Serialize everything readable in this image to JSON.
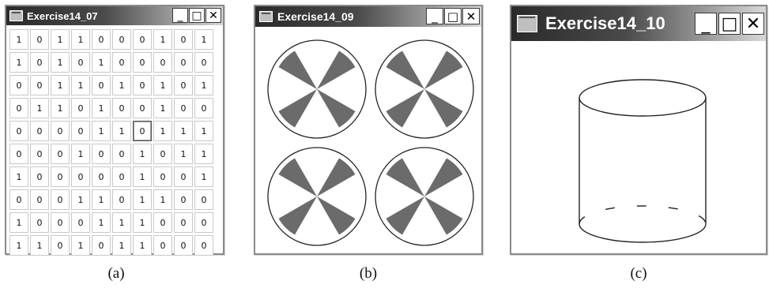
{
  "windows": {
    "a": {
      "title": "Exercise14_07",
      "controls": {
        "minimize": "_",
        "maximize": "□",
        "close": "✕"
      },
      "matrix": [
        [
          "1",
          "0",
          "1",
          "1",
          "0",
          "0",
          "0",
          "1",
          "0",
          "1"
        ],
        [
          "1",
          "0",
          "1",
          "0",
          "1",
          "0",
          "0",
          "0",
          "0",
          "0"
        ],
        [
          "0",
          "0",
          "1",
          "1",
          "0",
          "1",
          "0",
          "1",
          "0",
          "1"
        ],
        [
          "0",
          "1",
          "1",
          "0",
          "1",
          "0",
          "0",
          "1",
          "0",
          "0"
        ],
        [
          "0",
          "0",
          "0",
          "0",
          "1",
          "1",
          "0",
          "1",
          "1",
          "1"
        ],
        [
          "0",
          "0",
          "0",
          "1",
          "0",
          "0",
          "1",
          "0",
          "1",
          "1"
        ],
        [
          "1",
          "0",
          "0",
          "0",
          "0",
          "0",
          "1",
          "0",
          "0",
          "1"
        ],
        [
          "0",
          "0",
          "0",
          "1",
          "1",
          "0",
          "1",
          "1",
          "0",
          "0"
        ],
        [
          "1",
          "0",
          "0",
          "0",
          "1",
          "1",
          "1",
          "0",
          "0",
          "0"
        ],
        [
          "1",
          "1",
          "0",
          "1",
          "0",
          "1",
          "1",
          "0",
          "0",
          "0"
        ]
      ],
      "active_cell": {
        "row": 4,
        "col": 6
      }
    },
    "b": {
      "title": "Exercise14_09",
      "controls": {
        "minimize": "_",
        "maximize": "□",
        "close": "✕"
      },
      "fan_count": 4,
      "blade_color": "#6b6b6b"
    },
    "c": {
      "title": "Exercise14_10",
      "controls": {
        "minimize": "_",
        "maximize": "□",
        "close": "✕"
      },
      "shape": "cylinder"
    }
  },
  "captions": {
    "a": "(a)",
    "b": "(b)",
    "c": "(c)"
  },
  "colors": {
    "title_dark": "#2a2a2a",
    "title_light": "#d8d8d8",
    "border": "#8a8a8a"
  }
}
